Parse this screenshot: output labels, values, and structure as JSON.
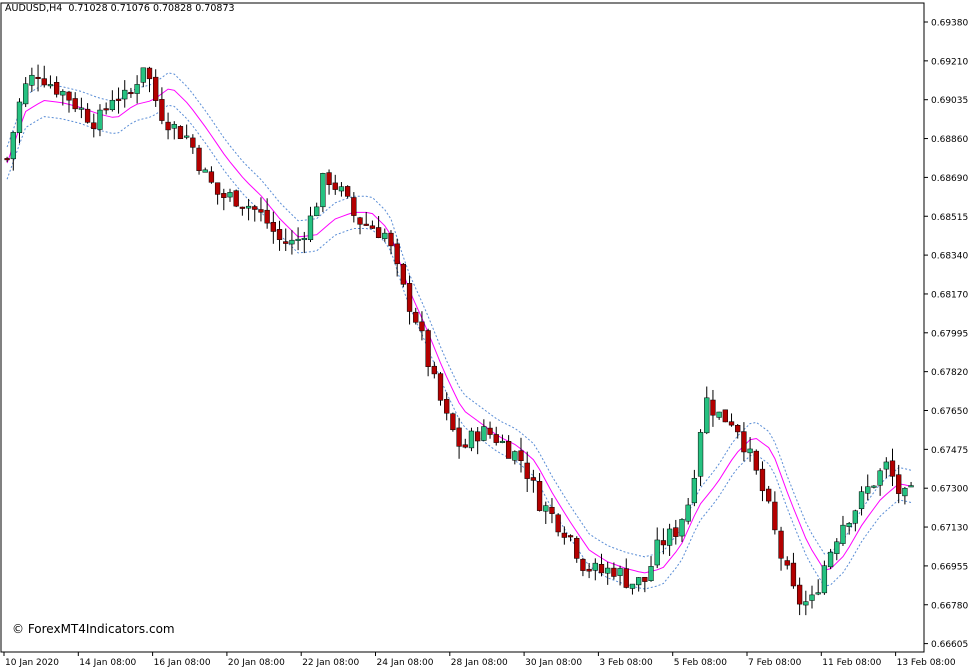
{
  "header": {
    "symbol": "AUDUSD,H4",
    "ohlc": "0.71028 0.71076 0.70828 0.70873"
  },
  "watermark": "© ForexMT4Indicators.com",
  "colors": {
    "bull": "#26c281",
    "bear": "#b30000",
    "ma": "#ff00ff",
    "band": "#5b8ed6",
    "grid": "#000000",
    "background": "#ffffff"
  },
  "chart_data": {
    "type": "candlestick",
    "title": "",
    "price_labels": [
      "0.69380",
      "0.69210",
      "0.69035",
      "0.68860",
      "0.68690",
      "0.68515",
      "0.68340",
      "0.68170",
      "0.67995",
      "0.67820",
      "0.67650",
      "0.67475",
      "0.67300",
      "0.67130",
      "0.66955",
      "0.66780",
      "0.66605"
    ],
    "time_labels": [
      "10 Jan 2020",
      "14 Jan 08:00",
      "16 Jan 08:00",
      "20 Jan 08:00",
      "22 Jan 08:00",
      "24 Jan 08:00",
      "28 Jan 08:00",
      "30 Jan 08:00",
      "3 Feb 08:00",
      "5 Feb 08:00",
      "7 Feb 08:00",
      "11 Feb 08:00",
      "13 Feb 08:00"
    ],
    "ylim": [
      0.6654,
      0.6946
    ],
    "close_anchors": [
      0.6877,
      0.6907,
      0.6916,
      0.691,
      0.6905,
      0.6898,
      0.6893,
      0.6906,
      0.6903,
      0.692,
      0.6899,
      0.6891,
      0.6886,
      0.687,
      0.686,
      0.686,
      0.6856,
      0.685,
      0.684,
      0.6839,
      0.685,
      0.687,
      0.6862,
      0.685,
      0.6847,
      0.6843,
      0.682,
      0.6805,
      0.678,
      0.676,
      0.6747,
      0.6755,
      0.6754,
      0.6748,
      0.6742,
      0.6725,
      0.6717,
      0.671,
      0.6696,
      0.6692,
      0.6694,
      0.6688,
      0.6688,
      0.6705,
      0.671,
      0.6725,
      0.677,
      0.6762,
      0.676,
      0.6743,
      0.6725,
      0.67,
      0.668,
      0.6678,
      0.6698,
      0.6714,
      0.6722,
      0.6732,
      0.674,
      0.6725,
      0.6728
    ],
    "ma_anchors": [
      0.6875,
      0.6898,
      0.6903,
      0.6902,
      0.69,
      0.6897,
      0.6895,
      0.6901,
      0.6903,
      0.6909,
      0.6901,
      0.689,
      0.6878,
      0.6868,
      0.686,
      0.685,
      0.6842,
      0.6843,
      0.685,
      0.6853,
      0.6853,
      0.6845,
      0.682,
      0.6802,
      0.6782,
      0.6765,
      0.6759,
      0.6753,
      0.6749,
      0.6742,
      0.6727,
      0.6714,
      0.6702,
      0.6697,
      0.6694,
      0.6692,
      0.6694,
      0.6704,
      0.6722,
      0.6732,
      0.6745,
      0.6753,
      0.6747,
      0.6725,
      0.6705,
      0.6692,
      0.67,
      0.6714,
      0.6725,
      0.6732,
      0.673
    ],
    "band_offset": 0.00045,
    "bars_per_label": 12
  }
}
